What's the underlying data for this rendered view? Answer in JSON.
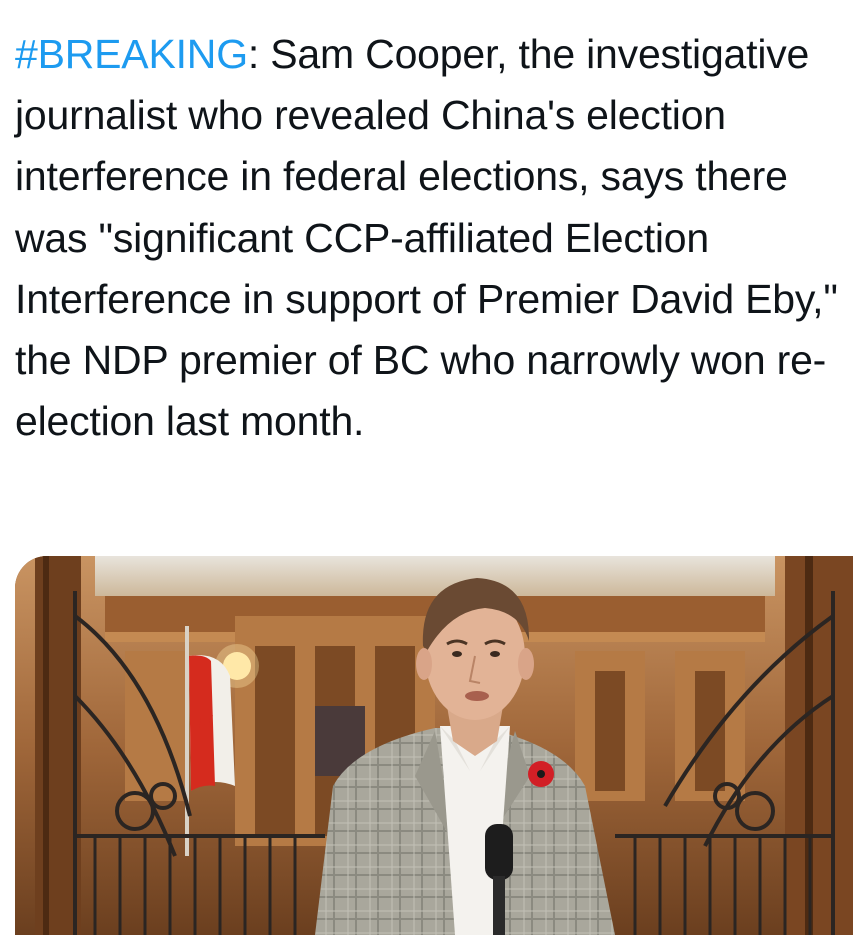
{
  "tweet": {
    "hashtag": "#BREAKING",
    "body": ": Sam Cooper, the investigative journalist who revealed China's election interference in federal elections, says there was \"significant CCP-affiliated Election Interference in support of Premier David Eby,\" the NDP premier of BC who narrowly won re-election last month."
  },
  "media": {
    "subject": "photo-of-man-at-microphone",
    "colors": {
      "wood": "#8a5a32",
      "wood_light": "#b07a48",
      "jacket": "#a9a79c",
      "shirt": "#f4f2ee",
      "poppy": "#d21f26",
      "flag_red": "#d52b1e"
    }
  }
}
